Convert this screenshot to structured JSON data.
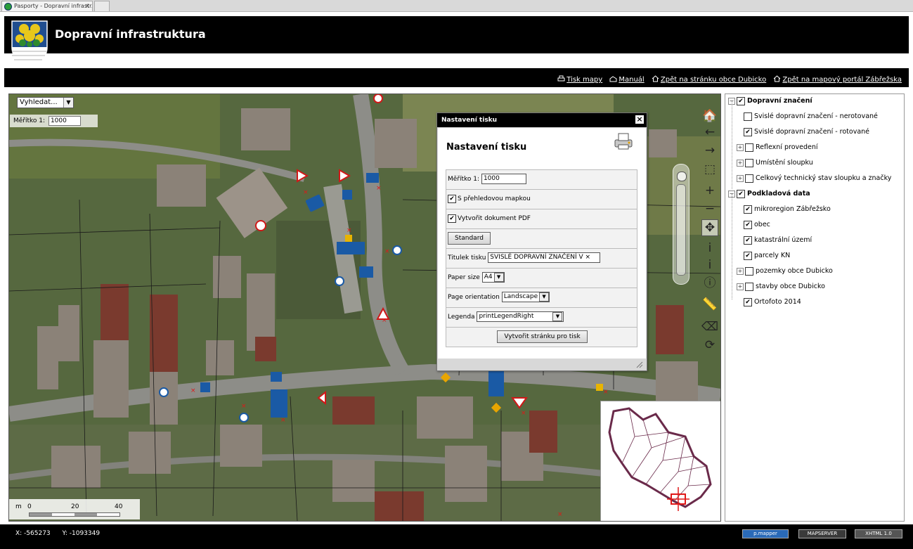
{
  "browser": {
    "tab_title": "Pasporty - Dopravní infrastr...",
    "tab_close": "×"
  },
  "header": {
    "title": "Dopravní infrastruktura"
  },
  "toolbar_links": [
    {
      "label": "Tisk mapy",
      "icon": "printer-icon"
    },
    {
      "label": "Manuál",
      "icon": "manual-icon"
    },
    {
      "label": "Zpět na stránku obce Dubicko",
      "icon": "home-icon"
    },
    {
      "label": "Zpět na mapový portál Zábřežska",
      "icon": "home-icon"
    }
  ],
  "map": {
    "search_value": "Vyhledat...",
    "scale_label": "Měřítko 1:",
    "scale_value": "1000",
    "scalebar": {
      "unit": "m",
      "ticks": [
        "0",
        "20",
        "40"
      ]
    }
  },
  "map_tools": [
    {
      "name": "home-icon",
      "glyph": "🏠"
    },
    {
      "name": "back-arrow-icon",
      "glyph": "←"
    },
    {
      "name": "forward-arrow-icon",
      "glyph": "→"
    },
    {
      "name": "zoom-box-icon",
      "glyph": "⬚"
    },
    {
      "name": "zoom-in-icon",
      "glyph": "+"
    },
    {
      "name": "zoom-out-icon",
      "glyph": "−"
    },
    {
      "name": "pan-icon",
      "glyph": "✥"
    },
    {
      "name": "info-icon",
      "glyph": "i"
    },
    {
      "name": "identify-icon",
      "glyph": "ⅰ"
    },
    {
      "name": "info-circle-icon",
      "glyph": "ⓘ"
    },
    {
      "name": "measure-icon",
      "glyph": "📏"
    },
    {
      "name": "clear-icon",
      "glyph": "⌫"
    },
    {
      "name": "refresh-icon",
      "glyph": "⟳"
    }
  ],
  "print_dialog": {
    "header": "Nastavení tisku",
    "title": "Nastavení tisku",
    "close": "×",
    "scale_label": "Měřítko 1:",
    "scale_value": "1000",
    "overview_label": "S přehledovou mapkou",
    "overview_checked": "✔",
    "pdf_label": "Vytvořit dokument PDF",
    "pdf_checked": "✔",
    "standard_button": "Standard",
    "title_label": "Titulek tisku",
    "title_value": "SVISLÉ DOPRAVNÍ ZNAČENÍ V ×",
    "paper_label": "Paper size",
    "paper_value": "A4",
    "orientation_label": "Page orientation",
    "orientation_value": "Landscape",
    "legend_label": "Legenda",
    "legend_value": "printLegendRight",
    "create_button": "Vytvořit stránku pro tisk"
  },
  "layer_tree": [
    {
      "label": "Dopravní značení",
      "level": 0,
      "bold": true,
      "checked": "✔",
      "expander": "−"
    },
    {
      "label": "Svislé dopravní značení - nerotované",
      "level": 1,
      "bold": false,
      "checked": "",
      "expander": ""
    },
    {
      "label": "Svislé dopravní značení - rotované",
      "level": 1,
      "bold": false,
      "checked": "✔",
      "expander": ""
    },
    {
      "label": "Reflexní provedení",
      "level": 1,
      "bold": false,
      "checked": "",
      "expander": "+"
    },
    {
      "label": "Umístění sloupku",
      "level": 1,
      "bold": false,
      "checked": "",
      "expander": "+"
    },
    {
      "label": "Celkový technický stav sloupku a značky",
      "level": 1,
      "bold": false,
      "checked": "",
      "expander": "+"
    },
    {
      "label": "Podkladová data",
      "level": 0,
      "bold": true,
      "checked": "✔",
      "expander": "−"
    },
    {
      "label": "mikroregion Zábřežsko",
      "level": 1,
      "bold": false,
      "checked": "✔",
      "expander": ""
    },
    {
      "label": "obec",
      "level": 1,
      "bold": false,
      "checked": "✔",
      "expander": ""
    },
    {
      "label": "katastrální území",
      "level": 1,
      "bold": false,
      "checked": "✔",
      "expander": ""
    },
    {
      "label": "parcely KN",
      "level": 1,
      "bold": false,
      "checked": "✔",
      "expander": ""
    },
    {
      "label": "pozemky obce Dubicko",
      "level": 1,
      "bold": false,
      "checked": "",
      "expander": "+"
    },
    {
      "label": "stavby obce Dubicko",
      "level": 1,
      "bold": false,
      "checked": "",
      "expander": "+"
    },
    {
      "label": "Ortofoto 2014",
      "level": 1,
      "bold": false,
      "checked": "✔",
      "expander": ""
    }
  ],
  "status": {
    "x": "X: -565273",
    "y": "Y: -1093349",
    "badges": [
      "p.mapper",
      "MAPSERVER",
      "XHTML 1.0"
    ]
  }
}
